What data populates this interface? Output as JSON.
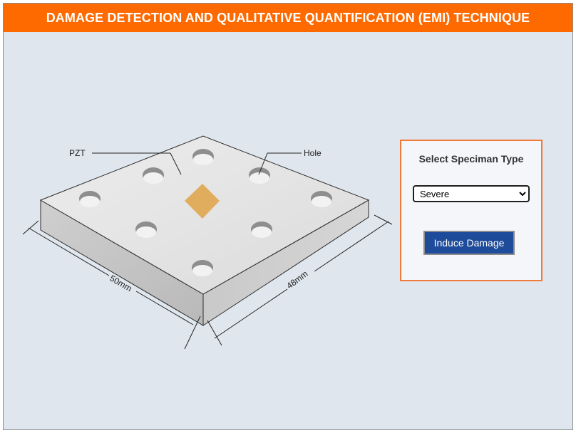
{
  "header": {
    "title": "DAMAGE DETECTION AND QUALITATIVE QUANTIFICATION (EMI) TECHNIQUE"
  },
  "diagram": {
    "pzt_label": "PZT",
    "hole_label": "Hole",
    "dim_left": "50mm",
    "dim_right": "48mm"
  },
  "panel": {
    "title": "Select Speciman Type",
    "select_value": "Severe",
    "button_label": "Induce Damage"
  },
  "colors": {
    "header": "#ff6a00",
    "background": "#dfe6ed",
    "panel_border": "#f07a3a",
    "button": "#1e4b9a",
    "pzt": "#e0ad5e"
  }
}
